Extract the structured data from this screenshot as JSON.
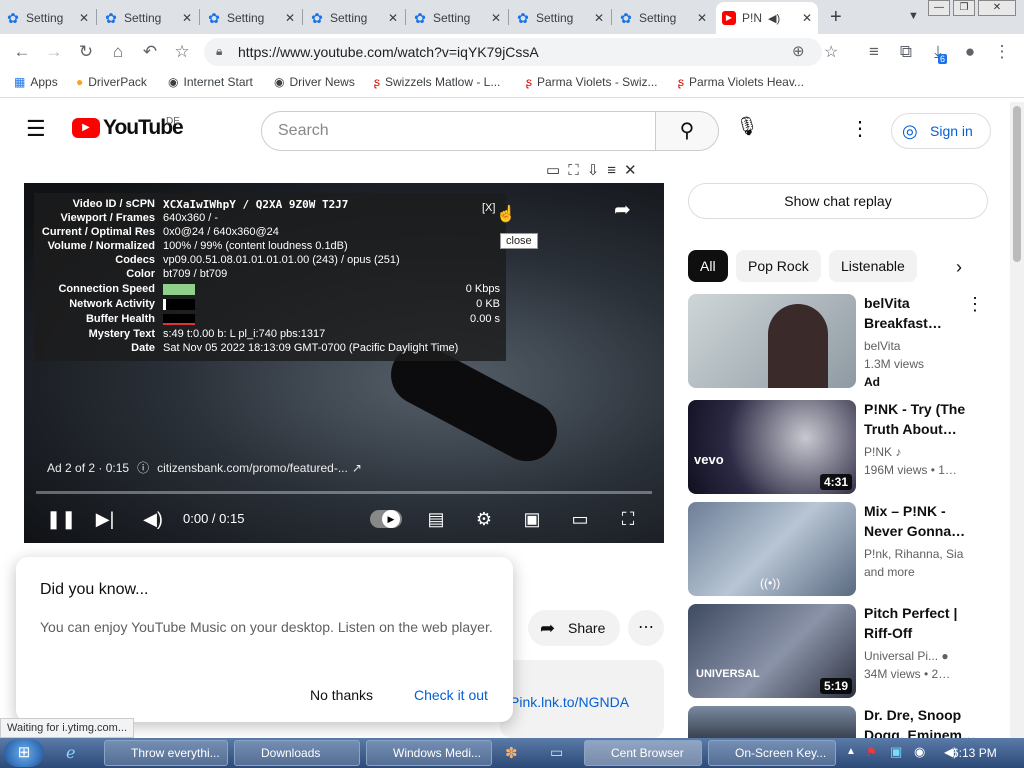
{
  "tabs": [
    {
      "label": "Setting",
      "close": "✕"
    },
    {
      "label": "Setting",
      "close": "✕"
    },
    {
      "label": "Setting",
      "close": "✕"
    },
    {
      "label": "Setting",
      "close": "✕"
    },
    {
      "label": "Setting",
      "close": "✕"
    },
    {
      "label": "Setting",
      "close": "✕"
    },
    {
      "label": "Setting",
      "close": "✕"
    },
    {
      "label": "P!N",
      "close": "✕"
    }
  ],
  "window": {
    "minimize": "—",
    "restore": "❐",
    "close": "✕"
  },
  "toolbar": {
    "url": "https://www.youtube.com/watch?v=iqYK79jCssA",
    "downloads_badge": "6"
  },
  "bookmarks": [
    "Apps",
    "DriverPack",
    "Internet Start",
    "Driver News",
    "Swizzels Matlow - L...",
    "Parma Violets - Swiz...",
    "Parma Violets Heav..."
  ],
  "yt": {
    "logo": "YouTube",
    "region": "DE",
    "search_placeholder": "Search",
    "sign_in": "Sign in"
  },
  "player": {
    "stats": [
      {
        "k": "Video ID / sCPN",
        "v": "XCXaIwIWhpY / Q2XA 9Z0W T2J7"
      },
      {
        "k": "Viewport / Frames",
        "v": "640x360 / -"
      },
      {
        "k": "Current / Optimal Res",
        "v": "0x0@24 / 640x360@24"
      },
      {
        "k": "Volume / Normalized",
        "v": "100% / 99% (content loudness 0.1dB)"
      },
      {
        "k": "Codecs",
        "v": "vp09.00.51.08.01.01.01.01.00 (243) / opus (251)"
      },
      {
        "k": "Color",
        "v": "bt709 / bt709"
      },
      {
        "k": "Connection Speed",
        "v": "0 Kbps"
      },
      {
        "k": "Network Activity",
        "v": "0 KB"
      },
      {
        "k": "Buffer Health",
        "v": "0.00 s"
      },
      {
        "k": "Mystery Text",
        "v": "s:49 t:0.00 b: L pl_i:740 pbs:1317"
      },
      {
        "k": "Date",
        "v": "Sat Nov 05 2022 18:13:09 GMT-0700 (Pacific Daylight Time)"
      }
    ],
    "stats_close": "[X]",
    "tooltip": "close",
    "ad_text": "Ad 2 of 2 · 0:15",
    "ad_link": "citizensbank.com/promo/featured-...",
    "time": "0:00 / 0:15",
    "progress": 0.0
  },
  "popup": {
    "title": "Did you know...",
    "body": "You can enjoy YouTube Music on your desktop. Listen on the web player.",
    "no": "No thanks",
    "yes": "Check it out"
  },
  "below": {
    "share": "Share",
    "link": "Pink.lnk.to/NGNDA"
  },
  "status": "Waiting for i.ytimg.com...",
  "sidebar": {
    "chat": "Show chat replay",
    "chips": [
      "All",
      "Pop Rock",
      "Listenable"
    ],
    "videos": [
      {
        "title": "belVita Breakfast…",
        "channel": "belVita",
        "meta": "1.3M views",
        "extra": "Ad",
        "duration": ""
      },
      {
        "title": "P!NK - Try (The Truth About…",
        "channel": "P!NK ♪",
        "meta": "196M views • 1…",
        "extra": "",
        "duration": "4:31"
      },
      {
        "title": "Mix – P!NK - Never Gonna…",
        "channel": "P!nk, Rihanna, Sia",
        "meta": "and more",
        "extra": "",
        "duration": ""
      },
      {
        "title": "Pitch Perfect | Riff-Off",
        "channel": "Universal Pi... ●",
        "meta": "34M views • 2…",
        "extra": "",
        "duration": "5:19"
      },
      {
        "title": "Dr. Dre, Snoop Dogg, Eminem…",
        "channel": "",
        "meta": "",
        "extra": "",
        "duration": ""
      }
    ]
  },
  "taskbar": {
    "items": [
      "Throw everythi...",
      "Downloads",
      "Windows Medi...",
      "Cent Browser",
      "On-Screen Key..."
    ],
    "clock": "6:13 PM"
  },
  "colors": {
    "yt_red": "#ff0000",
    "link_blue": "#065fd4",
    "chrome_blue": "#1a73e8"
  }
}
